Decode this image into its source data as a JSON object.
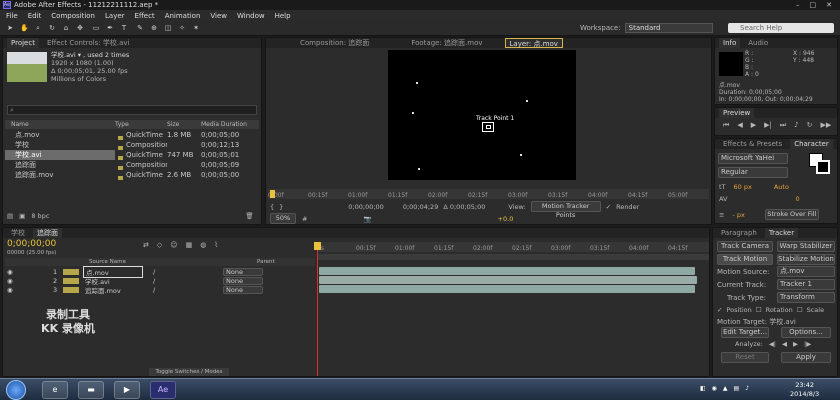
{
  "title": "Adobe After Effects - 11212211112.aep *",
  "menu": [
    "File",
    "Edit",
    "Composition",
    "Layer",
    "Effect",
    "Animation",
    "View",
    "Window",
    "Help"
  ],
  "workspace": {
    "label": "Workspace:",
    "value": "Standard"
  },
  "search_placeholder": "Search Help",
  "project": {
    "tabs": [
      "Project",
      "Effect Controls: 学校.avi"
    ],
    "selected_name": "学校.avi ▾ , used 2 times",
    "info1": "1920 x 1080 (1.00)",
    "info2": "Δ 0;00;05;01, 25.00 fps",
    "info3": "Millions of Colors",
    "columns": [
      "Name",
      "Type",
      "Size",
      "Media Duration"
    ],
    "items": [
      {
        "name": "点.mov",
        "type": "QuickTime",
        "size": "1.8 MB",
        "dur": "0;00;05;00"
      },
      {
        "name": "学校",
        "type": "Composition",
        "size": "",
        "dur": "0;00;12;13"
      },
      {
        "name": "学校.avi",
        "type": "QuickTime",
        "size": "747 MB",
        "dur": "0;00;05;01"
      },
      {
        "name": "追踪面",
        "type": "Composition",
        "size": "",
        "dur": "0;00;05;09"
      },
      {
        "name": "追踪面.mov",
        "type": "QuickTime",
        "size": "2.6 MB",
        "dur": "0;00;05;00"
      }
    ],
    "bpc": "8 bpc"
  },
  "viewer": {
    "tabs": [
      "Composition: 追踪面",
      "Footage: 追踪面.mov",
      "Layer: 点.mov"
    ],
    "track_point": "Track Point 1",
    "ruler": [
      "0:00f",
      "00:15f",
      "01:00f",
      "01:15f",
      "02:00f",
      "02:15f",
      "03:00f",
      "03:15f",
      "04:00f",
      "04:15f",
      "05:00f"
    ],
    "zoom": "50%",
    "time_start": "0;00;00;00",
    "time_end": "0;00;04;29",
    "duration": "Δ 0;00;05;00",
    "view_label": "View:",
    "view_value": "Motion Tracker Points",
    "render": "Render",
    "plus": "+0.0"
  },
  "info": {
    "tabs": [
      "Info",
      "Audio"
    ],
    "x": "X : 946",
    "y": "Y : 448",
    "r": "R :",
    "g": "G :",
    "b": "B :",
    "a": "A : 0",
    "name": "点.mov",
    "duration": "Duration: 0;00;05;00",
    "in_out": "In: 0;00;00;00, Out: 0;00;04;29"
  },
  "preview": {
    "tab": "Preview"
  },
  "char": {
    "tabs": [
      "Effects & Presets",
      "Character"
    ],
    "font": "Microsoft YaHei",
    "style": "Regular",
    "size": "60 px",
    "auto": "Auto",
    "zero": "0",
    "stroke_px": "- px",
    "stroke": "Stroke Over Fill"
  },
  "tracker": {
    "tabs": [
      "Paragraph",
      "Tracker"
    ],
    "track_camera": "Track Camera",
    "warp": "Warp Stabilizer",
    "track_motion": "Track Motion",
    "stabilize": "Stabilize Motion",
    "motion_source_label": "Motion Source:",
    "motion_source": "点.mov",
    "current_track_label": "Current Track:",
    "current_track": "Tracker 1",
    "track_type_label": "Track Type:",
    "track_type": "Transform",
    "position": "Position",
    "rotation": "Rotation",
    "scale": "Scale",
    "motion_target": "Motion Target: 学校.avi",
    "edit_target": "Edit Target...",
    "options": "Options...",
    "analyze": "Analyze:",
    "reset": "Reset",
    "apply": "Apply"
  },
  "timeline": {
    "tabs": [
      "学校",
      "追踪面"
    ],
    "timecode": "0;00;00;00",
    "fps": "00000 (25.00 fps)",
    "col_source": "Source Name",
    "col_parent": "Parent",
    "ruler": [
      "0s",
      "00:15f",
      "01:00f",
      "01:15f",
      "02:00f",
      "02:15f",
      "03:00f",
      "03:15f",
      "04:00f",
      "04:15f"
    ],
    "layers": [
      {
        "num": "1",
        "name": "点.mov",
        "parent": "None"
      },
      {
        "num": "2",
        "name": "学校.avi",
        "parent": "None"
      },
      {
        "num": "3",
        "name": "追踪面.mov",
        "parent": "None"
      }
    ],
    "toggle": "Toggle Switches / Modes"
  },
  "watermark": {
    "line1": "录制工具",
    "line2": "KK 录像机"
  },
  "taskbar": {
    "time": "23:42",
    "date": "2014/8/3",
    "ae": "Ae"
  }
}
